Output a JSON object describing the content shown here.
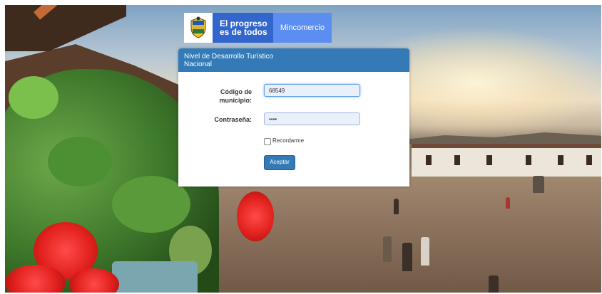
{
  "logo": {
    "emblem_icon": "colombia-coat-of-arms-icon",
    "primary_line1": "El progreso",
    "primary_line2": "es de todos",
    "secondary": "Mincomercio",
    "primary_color": "#3366cc",
    "secondary_color": "#5b8ef0"
  },
  "panel": {
    "title_line1": "Nivel de Desarrollo Turístico",
    "title_line2": "Nacional",
    "header_color": "#337ab7"
  },
  "form": {
    "municipio_label_line1": "Código de",
    "municipio_label_line2": "municipio:",
    "municipio_value": "68549",
    "password_label": "Contraseña:",
    "password_value": "••••",
    "remember_label": "Recordarme",
    "remember_checked": false,
    "submit_label": "Aceptar"
  }
}
